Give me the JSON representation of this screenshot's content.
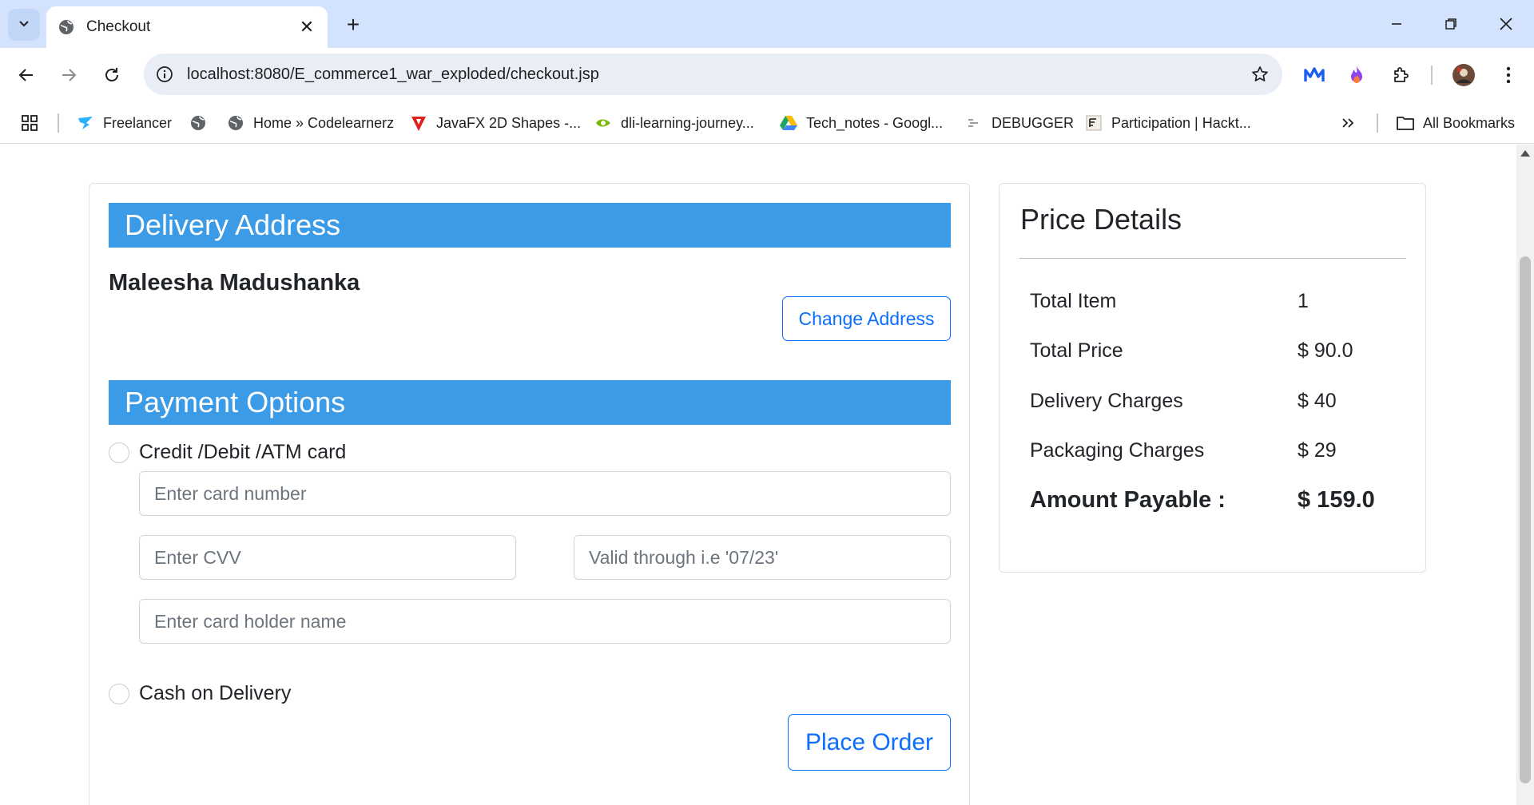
{
  "browser": {
    "tab": {
      "title": "Checkout"
    },
    "url": "localhost:8080/E_commerce1_war_exploded/checkout.jsp",
    "bookmarks": [
      {
        "label": "Freelancer",
        "icon": "freelancer-icon"
      },
      {
        "label": "",
        "icon": "globe-icon"
      },
      {
        "label": "Home » Codelearnerz",
        "icon": "globe-icon"
      },
      {
        "label": "JavaFX 2D Shapes -...",
        "icon": "red-triangle-icon"
      },
      {
        "label": "dli-learning-journey...",
        "icon": "nvidia-icon"
      },
      {
        "label": "Tech_notes - Googl...",
        "icon": "google-drive-icon"
      },
      {
        "label": "DEBUGGER",
        "icon": "debugger-icon"
      },
      {
        "label": "Participation | Hackt...",
        "icon": "hackathon-icon"
      }
    ],
    "all_bookmarks": "All Bookmarks"
  },
  "delivery": {
    "heading": "Delivery Address",
    "name": "Maleesha Madushanka",
    "change_button": "Change Address"
  },
  "payment": {
    "heading": "Payment Options",
    "option_card": "Credit /Debit /ATM card",
    "card_number_placeholder": "Enter card number",
    "cvv_placeholder": "Enter CVV",
    "valid_placeholder": "Valid through i.e '07/23'",
    "holder_placeholder": "Enter card holder name",
    "option_cod": "Cash on Delivery",
    "place_order": "Place Order"
  },
  "price": {
    "heading": "Price Details",
    "rows": [
      {
        "label": "Total Item",
        "value": "1"
      },
      {
        "label": "Total Price",
        "value": "$ 90.0"
      },
      {
        "label": "Delivery Charges",
        "value": "$ 40"
      },
      {
        "label": "Packaging Charges",
        "value": "$ 29"
      }
    ],
    "total_label": "Amount Payable :",
    "total_value": "$ 159.0"
  },
  "colors": {
    "section_bar": "#3c9be6",
    "primary": "#0d6efd",
    "tabstrip": "#d3e3fd"
  }
}
